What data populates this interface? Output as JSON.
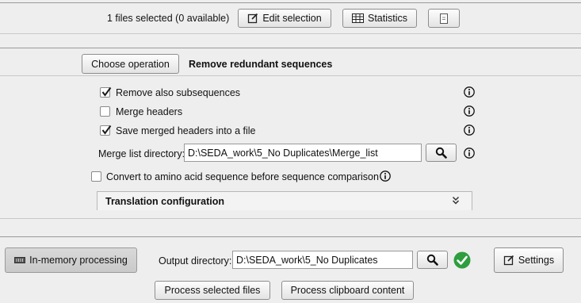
{
  "top_bar": {
    "files_selected": "1 files selected (0 available)",
    "edit_selection_label": "Edit selection",
    "statistics_label": "Statistics"
  },
  "operation": {
    "choose_label": "Choose operation",
    "current_operation": "Remove redundant sequences"
  },
  "options": {
    "remove_subsequences": {
      "label": "Remove also subsequences",
      "checked": true
    },
    "merge_headers": {
      "label": "Merge headers",
      "checked": false
    },
    "save_merged_headers": {
      "label": "Save merged headers into a file",
      "checked": true
    },
    "merge_list_dir_label": "Merge list directory:",
    "merge_list_dir_value": "D:\\SEDA_work\\5_No Duplicates\\Merge_list",
    "convert_amino": {
      "label": "Convert to amino acid sequence before sequence comparison",
      "checked": false
    },
    "translation_config_label": "Translation configuration"
  },
  "bottom": {
    "in_memory_label": "In-memory processing",
    "output_dir_label": "Output directory:",
    "output_dir_value": "D:\\SEDA_work\\5_No Duplicates",
    "settings_label": "Settings",
    "process_selected_label": "Process selected files",
    "process_clipboard_label": "Process clipboard content"
  },
  "colors": {
    "status_ok": "#2e9e3e",
    "background": "#eeeeee"
  }
}
